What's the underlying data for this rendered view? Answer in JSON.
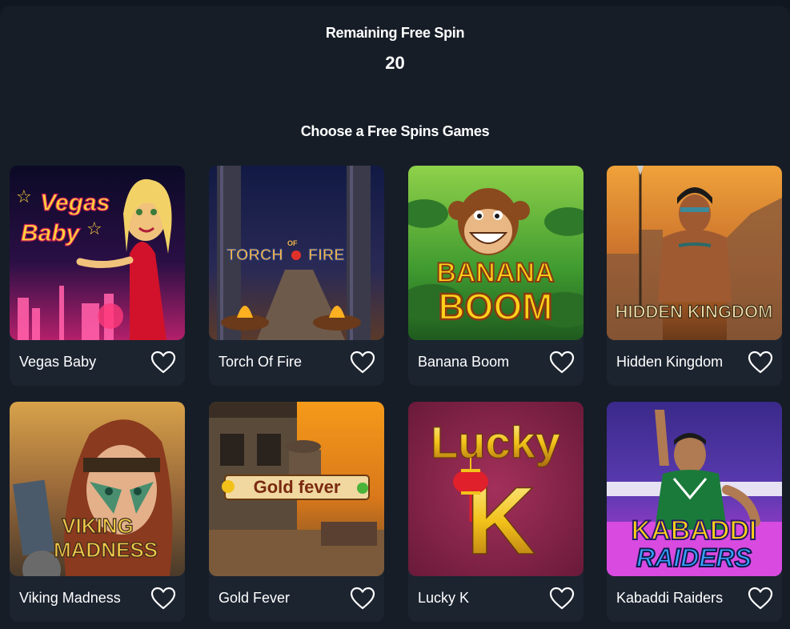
{
  "header": {
    "remaining_label": "Remaining Free Spin",
    "remaining_count": "20"
  },
  "section": {
    "title": "Choose a Free Spins Games"
  },
  "games": [
    {
      "title": "Vegas Baby",
      "logo": [
        "Vegas",
        "Baby"
      ]
    },
    {
      "title": "Torch Of Fire",
      "logo": [
        "TORCH",
        "OF",
        "FIRE"
      ]
    },
    {
      "title": "Banana Boom",
      "logo": [
        "BANANA",
        "BOOM"
      ]
    },
    {
      "title": "Hidden Kingdom",
      "logo": [
        "HIDDEN KINGDOM"
      ]
    },
    {
      "title": "Viking Madness",
      "logo": [
        "VIKING",
        "MADNESS"
      ]
    },
    {
      "title": "Gold Fever",
      "logo": [
        "Gold fever"
      ]
    },
    {
      "title": "Lucky K",
      "logo": [
        "Lucky",
        "K"
      ]
    },
    {
      "title": "Kabaddi Raiders",
      "logo": [
        "KABADDI",
        "RAIDERS"
      ]
    }
  ],
  "icons": {
    "favorite": "heart-outline-icon"
  },
  "colors": {
    "background": "#101720",
    "panel": "#161d27",
    "card": "#1c2430",
    "text": "#ffffff"
  }
}
